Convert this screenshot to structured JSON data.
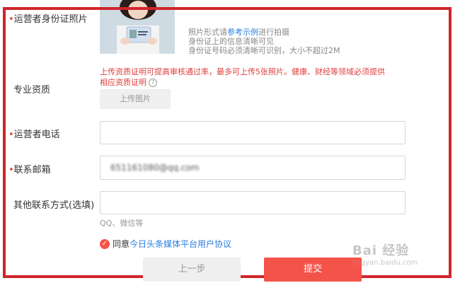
{
  "labels": {
    "id_photo": "运营者身份证照片",
    "qualification": "专业资质",
    "phone": "运营者电话",
    "email": "联系邮箱",
    "other_contact": "其他联系方式(选填)"
  },
  "id_photo_notes": {
    "line1_prefix": "照片形式请",
    "line1_link": "参考示例",
    "line1_suffix": "进行拍摄",
    "line2": "身份证上的信息清晰可见",
    "line3": "身份证号码必须清晰可识别，大小不超过2M"
  },
  "qualification_tip": {
    "line1": "上传资质证明可提高审核通过率，最多可上传5张照片。健康、财经等领域必须提供",
    "line2": "相应资质证明",
    "help_icon": "?"
  },
  "upload_button": "上传图片",
  "phone_input": {
    "value": ""
  },
  "email_input": {
    "value": "651161080@qq.com"
  },
  "other_contact_input": {
    "value": ""
  },
  "other_contact_hint": "QQ、微信等",
  "agreement": {
    "checked": true,
    "prefix": "同意",
    "link": "今日头条媒体平台用户协议"
  },
  "buttons": {
    "prev": "上一步",
    "submit": "提交"
  },
  "watermark": {
    "brand": "Bai 经验",
    "url": "jingyan.baidu.com"
  },
  "colors": {
    "accent": "#f4534a",
    "link": "#2a7de1",
    "frame": "#d0242b",
    "required": "#e04a3f"
  }
}
